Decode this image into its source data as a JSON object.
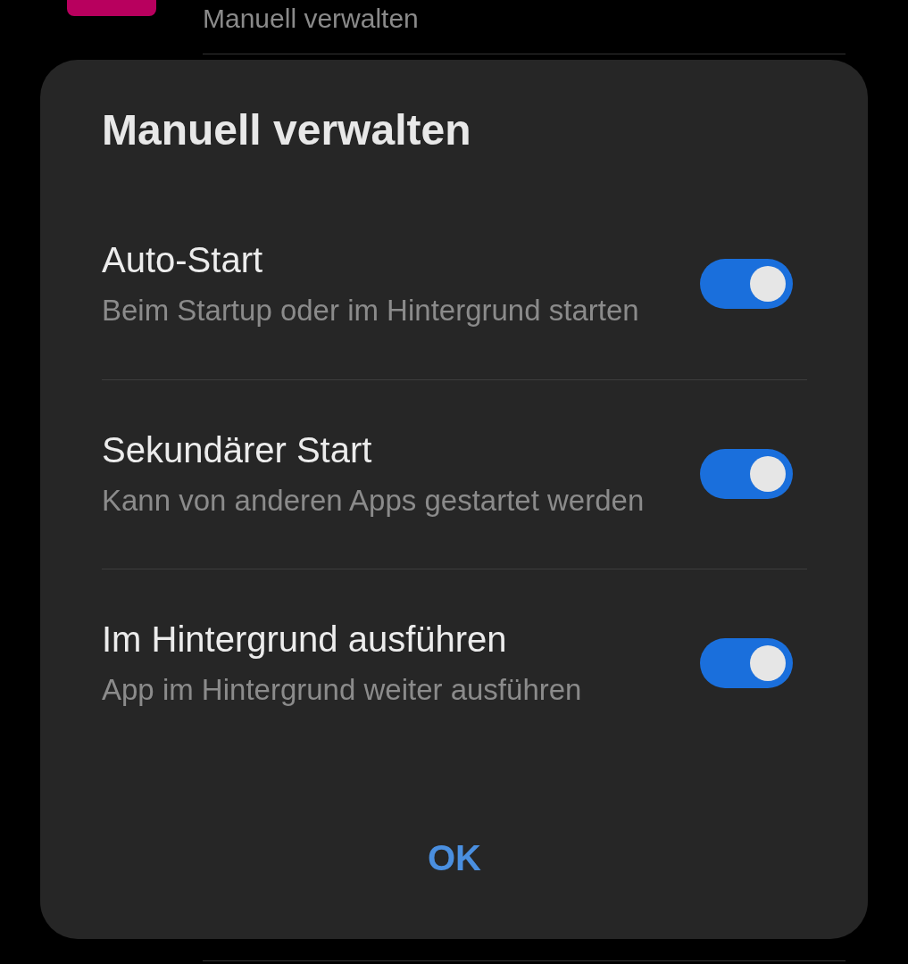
{
  "background_item": {
    "label": "Manuell verwalten"
  },
  "dialog": {
    "title": "Manuell verwalten",
    "settings": [
      {
        "title": "Auto-Start",
        "description": "Beim Startup oder im Hintergrund starten",
        "on": true
      },
      {
        "title": "Sekundärer Start",
        "description": "Kann von anderen Apps gestartet werden",
        "on": true
      },
      {
        "title": "Im Hintergrund ausführen",
        "description": "App im Hintergrund weiter ausführen",
        "on": true
      }
    ],
    "buttons": [
      "OK"
    ]
  }
}
